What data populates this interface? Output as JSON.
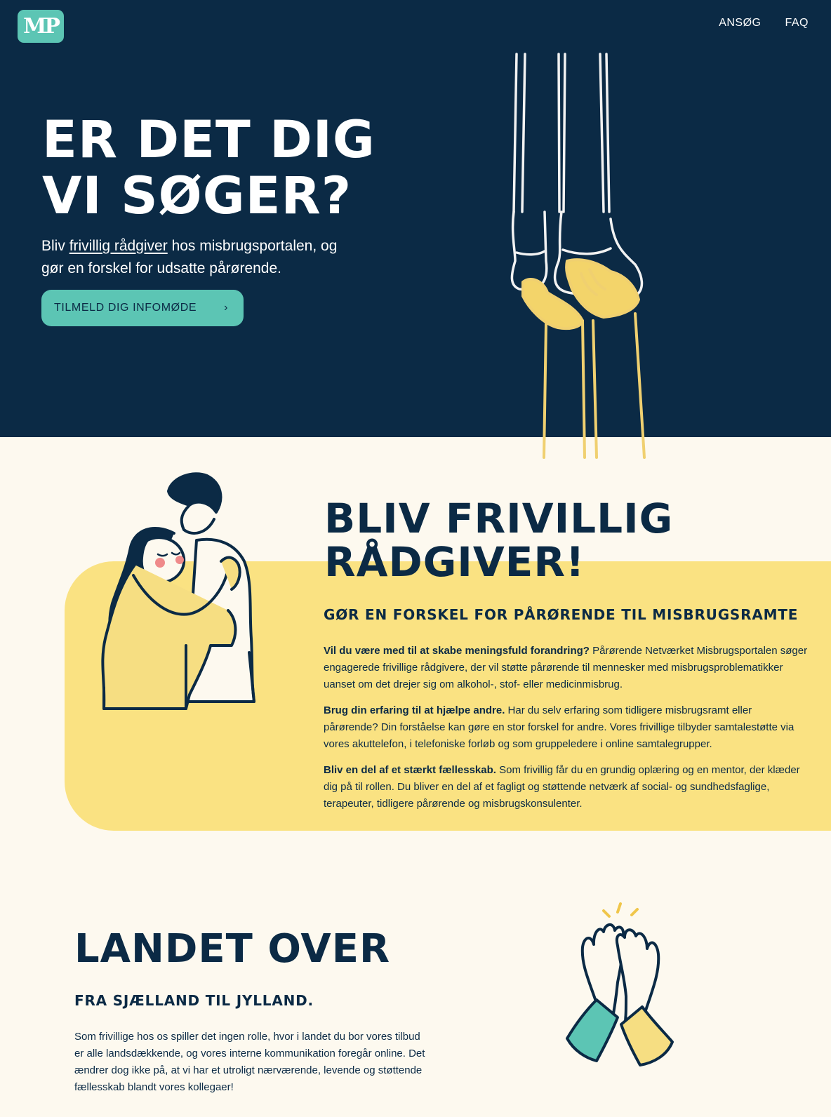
{
  "header": {
    "logo_text": "MP",
    "nav": [
      "ANSØG",
      "FAQ"
    ]
  },
  "hero": {
    "title_line1": "ER DET DIG",
    "title_line2": "VI SØGER?",
    "subtitle_pre": "Bliv ",
    "subtitle_link": "frivillig rådgiver",
    "subtitle_post": " hos misbrugsportalen, og gør en forskel for udsatte pårørende.",
    "cta_label": "TILMELD DIG INFOMØDE",
    "cta_chevron": "›"
  },
  "volunteer": {
    "title_line1": "BLIV FRIVILLIG",
    "title_line2": "RÅDGIVER!",
    "subtitle": "GØR EN FORSKEL FOR PÅRØRENDE TIL MISBRUGSRAMTE",
    "paragraphs": [
      {
        "bold": "Vil du være med til at skabe meningsfuld forandring?",
        "text": " Pårørende Netværket Misbrugsportalen søger engagerede frivillige rådgivere, der vil støtte pårørende til mennesker med misbrugsproblematikker uanset om det drejer sig om alkohol-, stof- eller medicinmisbrug."
      },
      {
        "bold": "Brug din erfaring til at hjælpe andre.",
        "text": " Har du selv erfaring som tidligere misbrugsramt eller pårørende? Din forståelse kan gøre en stor forskel for andre. Vores frivillige tilbyder samtalestøtte via vores akuttelefon, i telefoniske forløb og som gruppeledere i online samtalegrupper."
      },
      {
        "bold": "Bliv en del af et stærkt fællesskab.",
        "text": " Som frivillig får du en grundig oplæring og en mentor, der klæder dig på til rollen. Du bliver en del af et fagligt og støttende netværk af social- og sundhedsfaglige, terapeuter, tidligere pårørende og misbrugskonsulenter."
      }
    ]
  },
  "country": {
    "title": "LANDET OVER",
    "subtitle": "FRA SJÆLLAND TIL JYLLAND.",
    "body": "Som frivillige hos os spiller det ingen rolle, hvor i landet du bor vores tilbud er alle landsdækkende, og vores interne kommunikation foregår online. Det ændrer dog ikke på, at vi har et utroligt nærværende, levende og støttende fællesskab blandt vores kollegaer!"
  },
  "colors": {
    "navy": "#0b2a45",
    "teal": "#5cc5b4",
    "yellow": "#fae282",
    "cream": "#fdf9ef"
  },
  "illustrations": [
    "legs-hands-illustration",
    "hug-illustration",
    "high-five-illustration"
  ]
}
